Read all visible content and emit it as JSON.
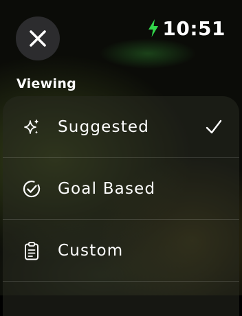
{
  "status": {
    "time": "10:51",
    "charging_icon": "bolt-icon",
    "charging_color": "#32d74b"
  },
  "close_button": {
    "icon": "close-icon"
  },
  "section": {
    "label": "Viewing"
  },
  "options": [
    {
      "label": "Suggested",
      "icon": "sparkles-icon",
      "selected": true
    },
    {
      "label": "Goal Based",
      "icon": "goal-check-icon",
      "selected": false
    },
    {
      "label": "Custom",
      "icon": "clipboard-icon",
      "selected": false
    }
  ]
}
